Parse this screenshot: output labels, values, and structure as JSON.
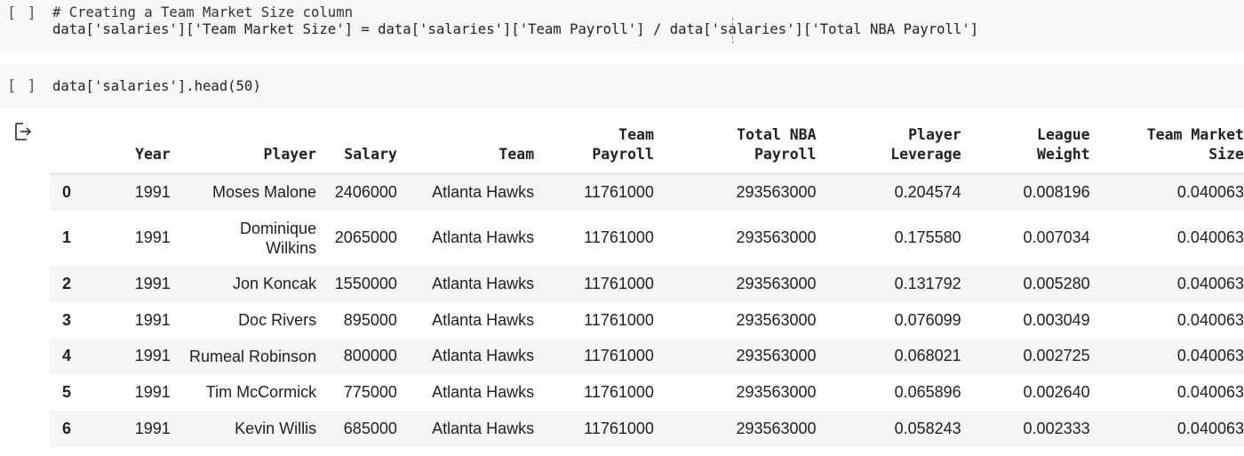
{
  "cells": [
    {
      "run_label": "[ ]",
      "code_lines": [
        "# Creating a Team Market Size column",
        "data['salaries']['Team Market Size'] = data['salaries']['Team Payroll'] / data['salaries']['Total NBA Payroll']"
      ]
    },
    {
      "run_label": "[ ]",
      "code_lines": [
        "data['salaries'].head(50)"
      ]
    }
  ],
  "output": {
    "icon": "output-arrow-icon",
    "columns": [
      {
        "line1": "",
        "line2": "Year"
      },
      {
        "line1": "",
        "line2": "Player"
      },
      {
        "line1": "",
        "line2": "Salary"
      },
      {
        "line1": "",
        "line2": "Team"
      },
      {
        "line1": "Team",
        "line2": "Payroll"
      },
      {
        "line1": "Total NBA",
        "line2": "Payroll"
      },
      {
        "line1": "Player",
        "line2": "Leverage"
      },
      {
        "line1": "League",
        "line2": "Weight"
      },
      {
        "line1": "Team Market",
        "line2": "Size"
      }
    ],
    "rows": [
      {
        "index": "0",
        "cells": [
          "1991",
          "Moses Malone",
          "2406000",
          "Atlanta Hawks",
          "11761000",
          "293563000",
          "0.204574",
          "0.008196",
          "0.040063"
        ]
      },
      {
        "index": "1",
        "cells": [
          "1991",
          "Dominique Wilkins",
          "2065000",
          "Atlanta Hawks",
          "11761000",
          "293563000",
          "0.175580",
          "0.007034",
          "0.040063"
        ]
      },
      {
        "index": "2",
        "cells": [
          "1991",
          "Jon Koncak",
          "1550000",
          "Atlanta Hawks",
          "11761000",
          "293563000",
          "0.131792",
          "0.005280",
          "0.040063"
        ]
      },
      {
        "index": "3",
        "cells": [
          "1991",
          "Doc Rivers",
          "895000",
          "Atlanta Hawks",
          "11761000",
          "293563000",
          "0.076099",
          "0.003049",
          "0.040063"
        ]
      },
      {
        "index": "4",
        "cells": [
          "1991",
          "Rumeal Robinson",
          "800000",
          "Atlanta Hawks",
          "11761000",
          "293563000",
          "0.068021",
          "0.002725",
          "0.040063"
        ]
      },
      {
        "index": "5",
        "cells": [
          "1991",
          "Tim McCormick",
          "775000",
          "Atlanta Hawks",
          "11761000",
          "293563000",
          "0.065896",
          "0.002640",
          "0.040063"
        ]
      },
      {
        "index": "6",
        "cells": [
          "1991",
          "Kevin Willis",
          "685000",
          "Atlanta Hawks",
          "11761000",
          "293563000",
          "0.058243",
          "0.002333",
          "0.040063"
        ]
      }
    ]
  }
}
